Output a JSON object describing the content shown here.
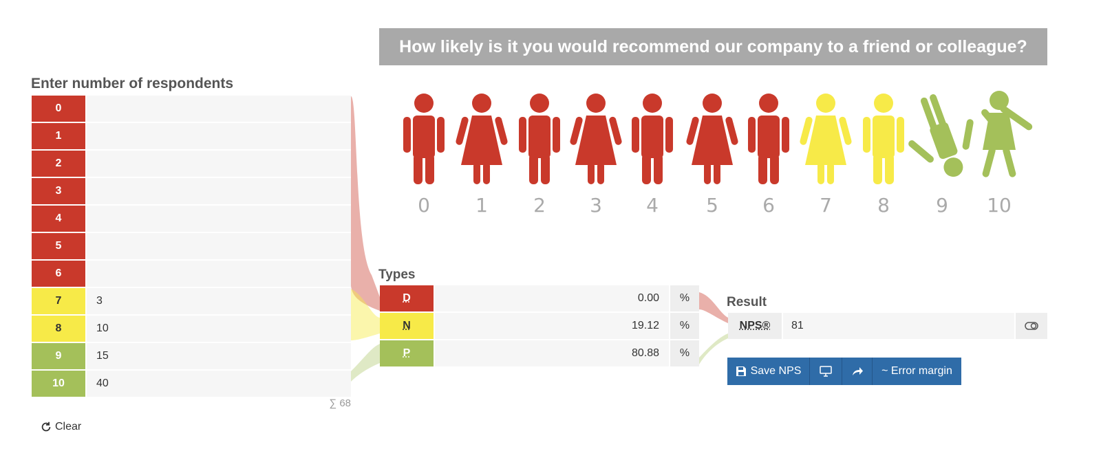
{
  "question": "How likely is it you would recommend our company to a friend or colleague?",
  "respondents": {
    "title": "Enter number of respondents",
    "rows": [
      {
        "score": "0",
        "value": ""
      },
      {
        "score": "1",
        "value": ""
      },
      {
        "score": "2",
        "value": ""
      },
      {
        "score": "3",
        "value": ""
      },
      {
        "score": "4",
        "value": ""
      },
      {
        "score": "5",
        "value": ""
      },
      {
        "score": "6",
        "value": ""
      },
      {
        "score": "7",
        "value": "3"
      },
      {
        "score": "8",
        "value": "10"
      },
      {
        "score": "9",
        "value": "15"
      },
      {
        "score": "10",
        "value": "40"
      }
    ],
    "sum": "∑ 68",
    "clear_label": "Clear"
  },
  "scale_numbers": [
    "0",
    "1",
    "2",
    "3",
    "4",
    "5",
    "6",
    "7",
    "8",
    "9",
    "10"
  ],
  "types": {
    "title": "Types",
    "rows": [
      {
        "label": "D",
        "value": "0.00",
        "unit": "%"
      },
      {
        "label": "N",
        "value": "19.12",
        "unit": "%"
      },
      {
        "label": "P",
        "value": "80.88",
        "unit": "%"
      }
    ]
  },
  "result": {
    "title": "Result",
    "label": "NPS®",
    "value": "81"
  },
  "buttons": {
    "save": "Save NPS",
    "error_margin": "~ Error margin"
  },
  "colors": {
    "detractor": "#c9392b",
    "passive": "#f7ea48",
    "promoter": "#a4c05a",
    "banner": "#a9a9a9",
    "button": "#2f6ca8"
  }
}
